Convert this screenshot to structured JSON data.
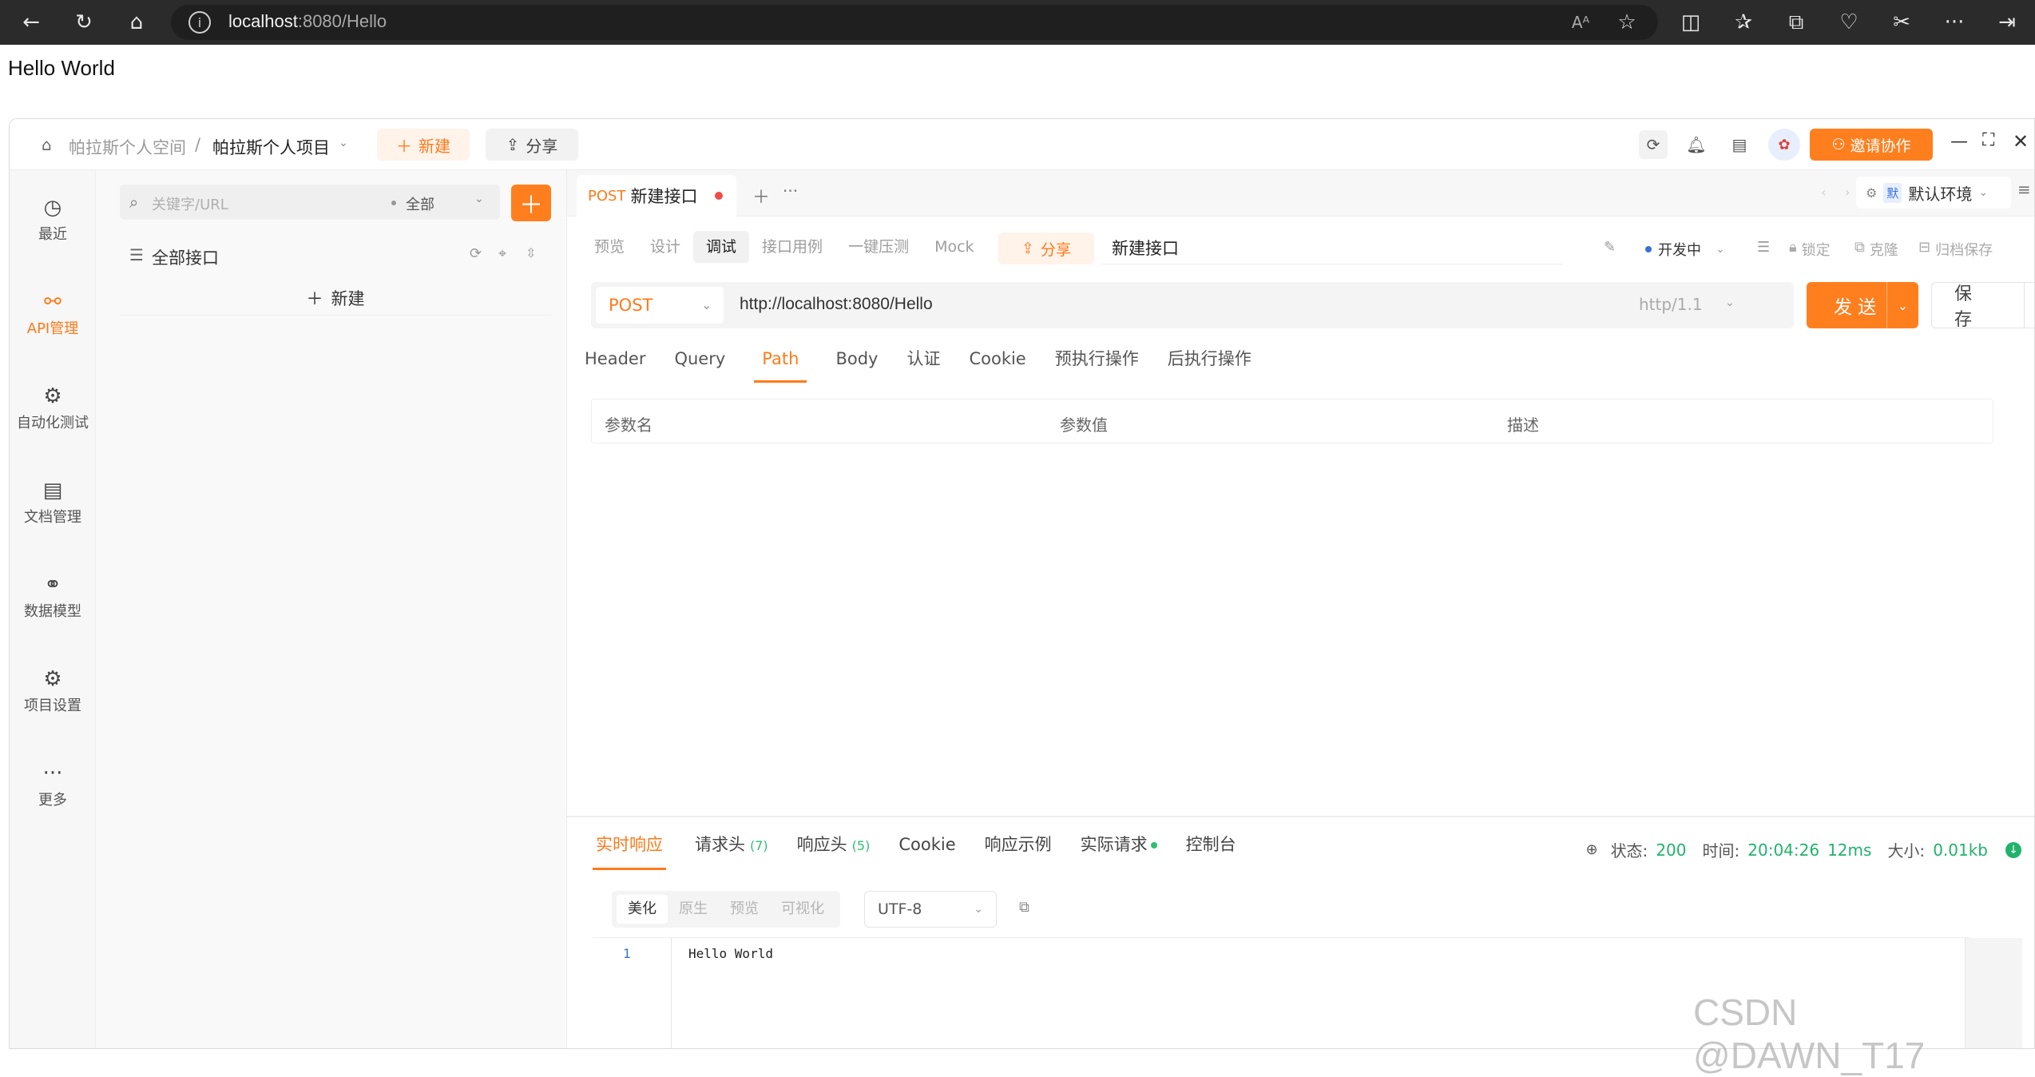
{
  "browser": {
    "url_host": "localhost",
    "url_rest": ":8080/Hello",
    "read_aloud": "Aᴾ"
  },
  "page": {
    "hello": "Hello World"
  },
  "app": {
    "breadcrumb": {
      "space": "帕拉斯个人空间",
      "sep": "/",
      "project": "帕拉斯个人项目"
    },
    "new_label": "新建",
    "share_label": "分享",
    "invite_label": "邀请协作"
  },
  "rail": [
    {
      "label": "最近",
      "icon": "history-icon",
      "glyph": "◷"
    },
    {
      "label": "API管理",
      "icon": "api-icon",
      "glyph": "⚯"
    },
    {
      "label": "自动化测试",
      "icon": "automation-icon",
      "glyph": "⚙"
    },
    {
      "label": "文档管理",
      "icon": "document-icon",
      "glyph": "▤"
    },
    {
      "label": "数据模型",
      "icon": "data-model-icon",
      "glyph": "⚭"
    },
    {
      "label": "项目设置",
      "icon": "project-settings-icon",
      "glyph": "⚙"
    },
    {
      "label": "更多",
      "icon": "more-icon",
      "glyph": "···"
    }
  ],
  "tree": {
    "search_placeholder": "关键字/URL",
    "filter": "全部",
    "all_api": "全部接口",
    "new_label": "新建"
  },
  "request_tab": {
    "method": "POST",
    "name": "新建接口"
  },
  "env": {
    "badge": "默",
    "name": "默认环境"
  },
  "mode_tabs": [
    "预览",
    "设计",
    "调试",
    "接口用例",
    "一键压测",
    "Mock"
  ],
  "mode_active": "调试",
  "share_label": "分享",
  "api_name": "新建接口",
  "right_meta": {
    "status": "开发中",
    "lock": "锁定",
    "clone": "克隆",
    "archive": "归档保存"
  },
  "request": {
    "method": "POST",
    "url": "http://localhost:8080/Hello",
    "http_version": "http/1.1",
    "send": "发 送",
    "save": "保 存"
  },
  "param_tabs": [
    "Header",
    "Query",
    "Path",
    "Body",
    "认证",
    "Cookie",
    "预执行操作",
    "后执行操作"
  ],
  "param_active": "Path",
  "param_columns": [
    "参数名",
    "参数值",
    "描述"
  ],
  "response": {
    "tabs": [
      {
        "label": "实时响应",
        "count": ""
      },
      {
        "label": "请求头",
        "count": "(7)"
      },
      {
        "label": "响应头",
        "count": "(5)"
      },
      {
        "label": "Cookie",
        "count": ""
      },
      {
        "label": "响应示例",
        "count": ""
      },
      {
        "label": "实际请求",
        "count": ""
      },
      {
        "label": "控制台",
        "count": ""
      }
    ],
    "status_label": "状态:",
    "status": "200",
    "time_label": "时间:",
    "time": "20:04:26",
    "duration": "12ms",
    "size_label": "大小:",
    "size": "0.01kb",
    "formats": [
      "美化",
      "原生",
      "预览",
      "可视化"
    ],
    "format_active": "美化",
    "encoding": "UTF-8",
    "line": "1",
    "body": "Hello World"
  },
  "watermark": "CSDN @DAWN_T17",
  "colors": {
    "accent": "#ff7f1e",
    "success": "#21b36b"
  }
}
